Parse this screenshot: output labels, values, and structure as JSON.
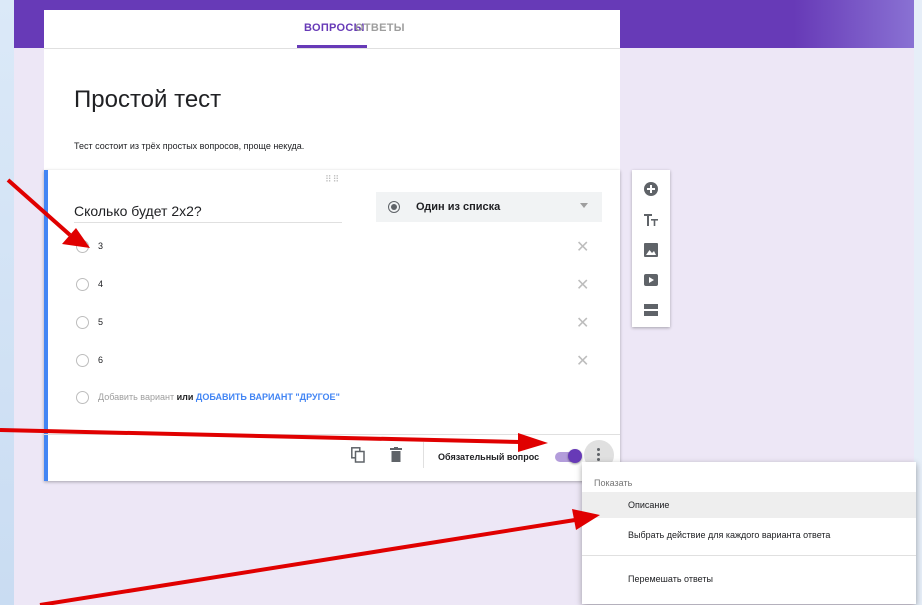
{
  "tabs": {
    "questions": "ВОПРОСЫ",
    "answers": "ОТВЕТЫ"
  },
  "form": {
    "title": "Простой тест",
    "description": "Тест состоит из трёх простых вопросов, проще некуда."
  },
  "question": {
    "title": "Сколько будет 2х2?",
    "type_label": "Один из списка",
    "options": [
      "3",
      "4",
      "5",
      "6"
    ],
    "add_option": "Добавить вариант",
    "or": "или",
    "add_other": "ДОБАВИТЬ ВАРИАНТ \"ДРУГОЕ\"",
    "required_label": "Обязательный вопрос"
  },
  "menu": {
    "header": "Показать",
    "items": [
      "Описание",
      "Выбрать действие для каждого варианта ответа",
      "Перемешать ответы"
    ]
  },
  "colors": {
    "accent": "#673ab7",
    "link": "#4285f4",
    "arrow": "#ff0000"
  }
}
